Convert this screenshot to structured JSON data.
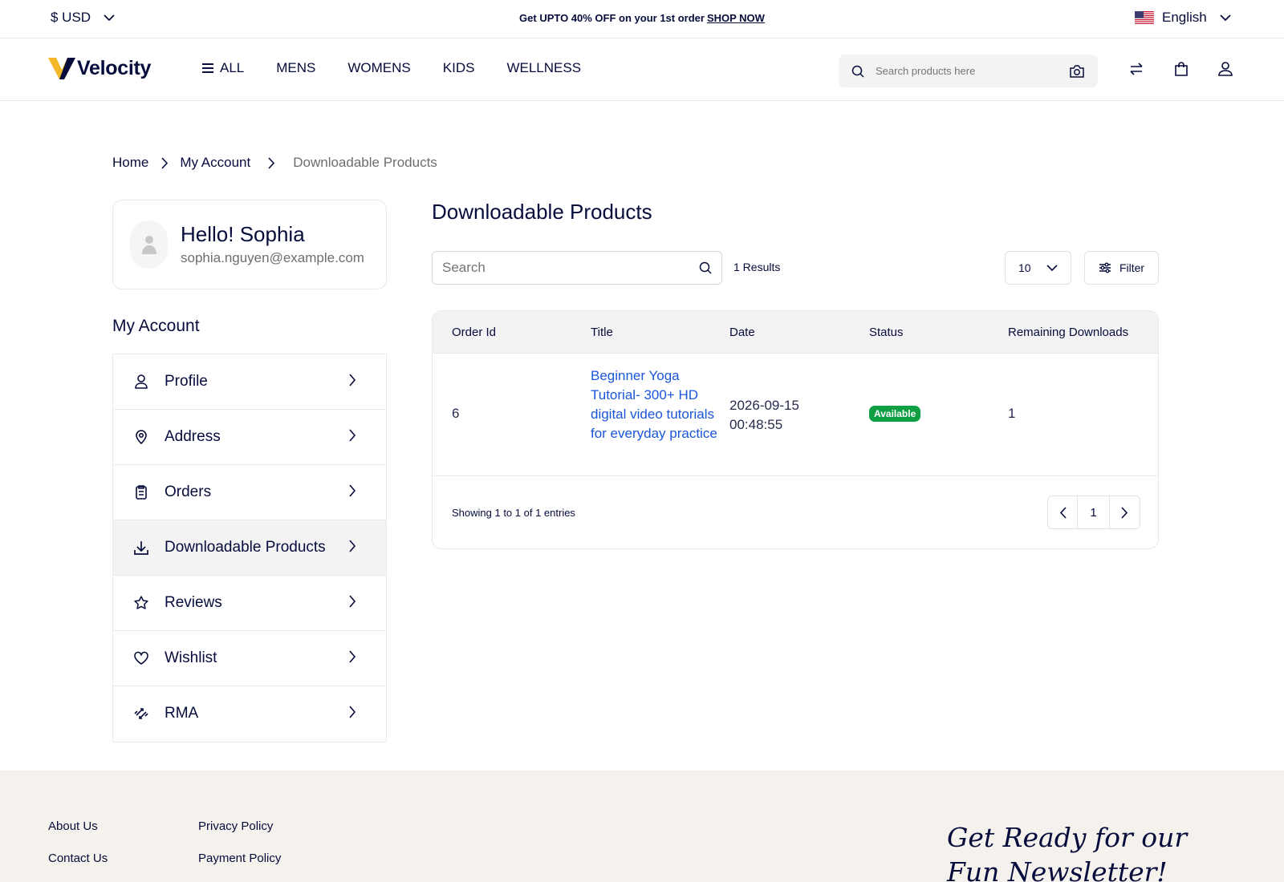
{
  "topbar": {
    "currency": "$ USD",
    "promo_text": "Get UPTO 40% OFF on your 1st order",
    "promo_link": "SHOP NOW",
    "language": "English"
  },
  "header": {
    "logo_text": "Velocity",
    "nav": [
      "ALL",
      "MENS",
      "WOMENS",
      "KIDS",
      "WELLNESS"
    ],
    "search_placeholder": "Search products here"
  },
  "breadcrumb": {
    "home": "Home",
    "account": "My Account",
    "current": "Downloadable Products"
  },
  "profile": {
    "greeting": "Hello! Sophia",
    "email": "sophia.nguyen@example.com"
  },
  "sidebar": {
    "title": "My Account",
    "items": [
      {
        "label": "Profile",
        "icon": "user-icon"
      },
      {
        "label": "Address",
        "icon": "location-pin-icon"
      },
      {
        "label": "Orders",
        "icon": "clipboard-icon"
      },
      {
        "label": "Downloadable Products",
        "icon": "download-icon",
        "active": true
      },
      {
        "label": "Reviews",
        "icon": "star-icon"
      },
      {
        "label": "Wishlist",
        "icon": "heart-icon"
      },
      {
        "label": "RMA",
        "icon": "rma-arrows-icon"
      }
    ]
  },
  "main": {
    "title": "Downloadable Products",
    "search_placeholder": "Search",
    "results": "1 Results",
    "per_page": "10",
    "filter_label": "Filter",
    "columns": [
      "Order Id",
      "Title",
      "Date",
      "Status",
      "Remaining Downloads"
    ],
    "rows": [
      {
        "order_id": "6",
        "title": "Beginner Yoga Tutorial- 300+ HD digital video tutorials for everyday practice",
        "date": "2026-09-15 00:48:55",
        "status": "Available",
        "remaining": "1"
      }
    ],
    "showing": "Showing 1 to 1 of 1 entries",
    "page": "1"
  },
  "footer": {
    "links_col1": [
      "About Us",
      "Contact Us"
    ],
    "links_col2": [
      "Privacy Policy",
      "Payment Policy"
    ],
    "newsletter": "Get Ready for our Fun Newsletter!"
  },
  "colors": {
    "primary": "#060c3b",
    "link": "#1a56db",
    "status_available": "#0e9f45",
    "footer_bg": "#f5f1ec",
    "logo_yellow": "#f4b728"
  }
}
